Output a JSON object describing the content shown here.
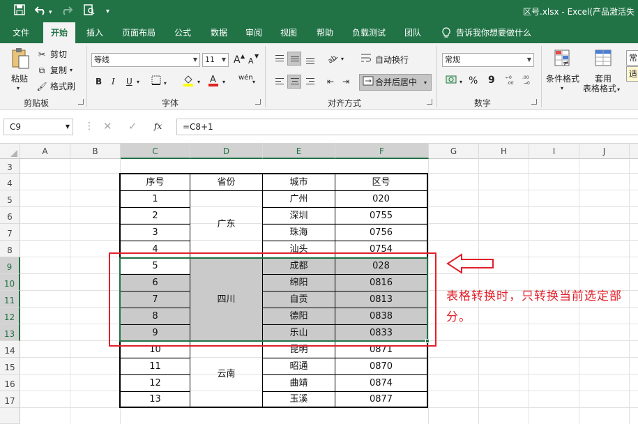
{
  "window": {
    "title": "区号.xlsx  -  Excel(产品激活失"
  },
  "quick_access": {
    "save": "save-icon",
    "undo": "undo-icon",
    "redo": "redo-icon",
    "print_preview": "print-preview-icon"
  },
  "ribbon_tabs": [
    {
      "label": "文件"
    },
    {
      "label": "开始"
    },
    {
      "label": "插入"
    },
    {
      "label": "页面布局"
    },
    {
      "label": "公式"
    },
    {
      "label": "数据"
    },
    {
      "label": "审阅"
    },
    {
      "label": "视图"
    },
    {
      "label": "帮助"
    },
    {
      "label": "负载测试"
    },
    {
      "label": "团队"
    },
    {
      "label": "告诉我你想要做什么"
    }
  ],
  "ribbon": {
    "clipboard": {
      "paste": "粘贴",
      "cut": "剪切",
      "copy": "复制",
      "format_painter": "格式刷",
      "label": "剪贴板"
    },
    "font": {
      "name": "等线",
      "size": "11",
      "bold": "B",
      "italic": "I",
      "underline": "U",
      "grow": "A",
      "shrink": "A",
      "phonetic": "wén",
      "label": "字体"
    },
    "alignment": {
      "wrap": "自动换行",
      "merge": "合并后居中",
      "label": "对齐方式"
    },
    "number": {
      "format": "常规",
      "percent": "%",
      "comma": "9",
      "label": "数字"
    },
    "styles": {
      "conditional": "条件格式",
      "table_format_1": "套用",
      "table_format_2": "表格格式",
      "cell_style_1": "常",
      "cell_style_2": "适"
    }
  },
  "formula_bar": {
    "name_box": "C9",
    "fx": "fx",
    "formula": "=C8+1"
  },
  "columns": [
    "A",
    "B",
    "C",
    "D",
    "E",
    "F",
    "G",
    "H",
    "I",
    "J"
  ],
  "rows": [
    "3",
    "4",
    "5",
    "6",
    "7",
    "8",
    "9",
    "10",
    "11",
    "12",
    "13",
    "14",
    "15",
    "16",
    "17"
  ],
  "table": {
    "headers": [
      "序号",
      "省份",
      "城市",
      "区号"
    ],
    "rows": [
      {
        "seq": "1",
        "city": "广州",
        "code": "020"
      },
      {
        "seq": "2",
        "city": "深圳",
        "code": "0755"
      },
      {
        "seq": "3",
        "city": "珠海",
        "code": "0756"
      },
      {
        "seq": "4",
        "city": "汕头",
        "code": "0754"
      },
      {
        "seq": "5",
        "city": "成都",
        "code": "028"
      },
      {
        "seq": "6",
        "city": "绵阳",
        "code": "0816"
      },
      {
        "seq": "7",
        "city": "自贡",
        "code": "0813"
      },
      {
        "seq": "8",
        "city": "德阳",
        "code": "0838"
      },
      {
        "seq": "9",
        "city": "乐山",
        "code": "0833"
      },
      {
        "seq": "10",
        "city": "昆明",
        "code": "0871"
      },
      {
        "seq": "11",
        "city": "昭通",
        "code": "0870"
      },
      {
        "seq": "12",
        "city": "曲靖",
        "code": "0874"
      },
      {
        "seq": "13",
        "city": "玉溪",
        "code": "0877"
      }
    ],
    "provinces": [
      "广东",
      "四川",
      "云南"
    ]
  },
  "annotation": {
    "note": "表格转换时，只转换当前选定部分。",
    "color": "#e0202a"
  },
  "colors": {
    "accent": "#217346",
    "selection_fill": "#cacaca"
  }
}
